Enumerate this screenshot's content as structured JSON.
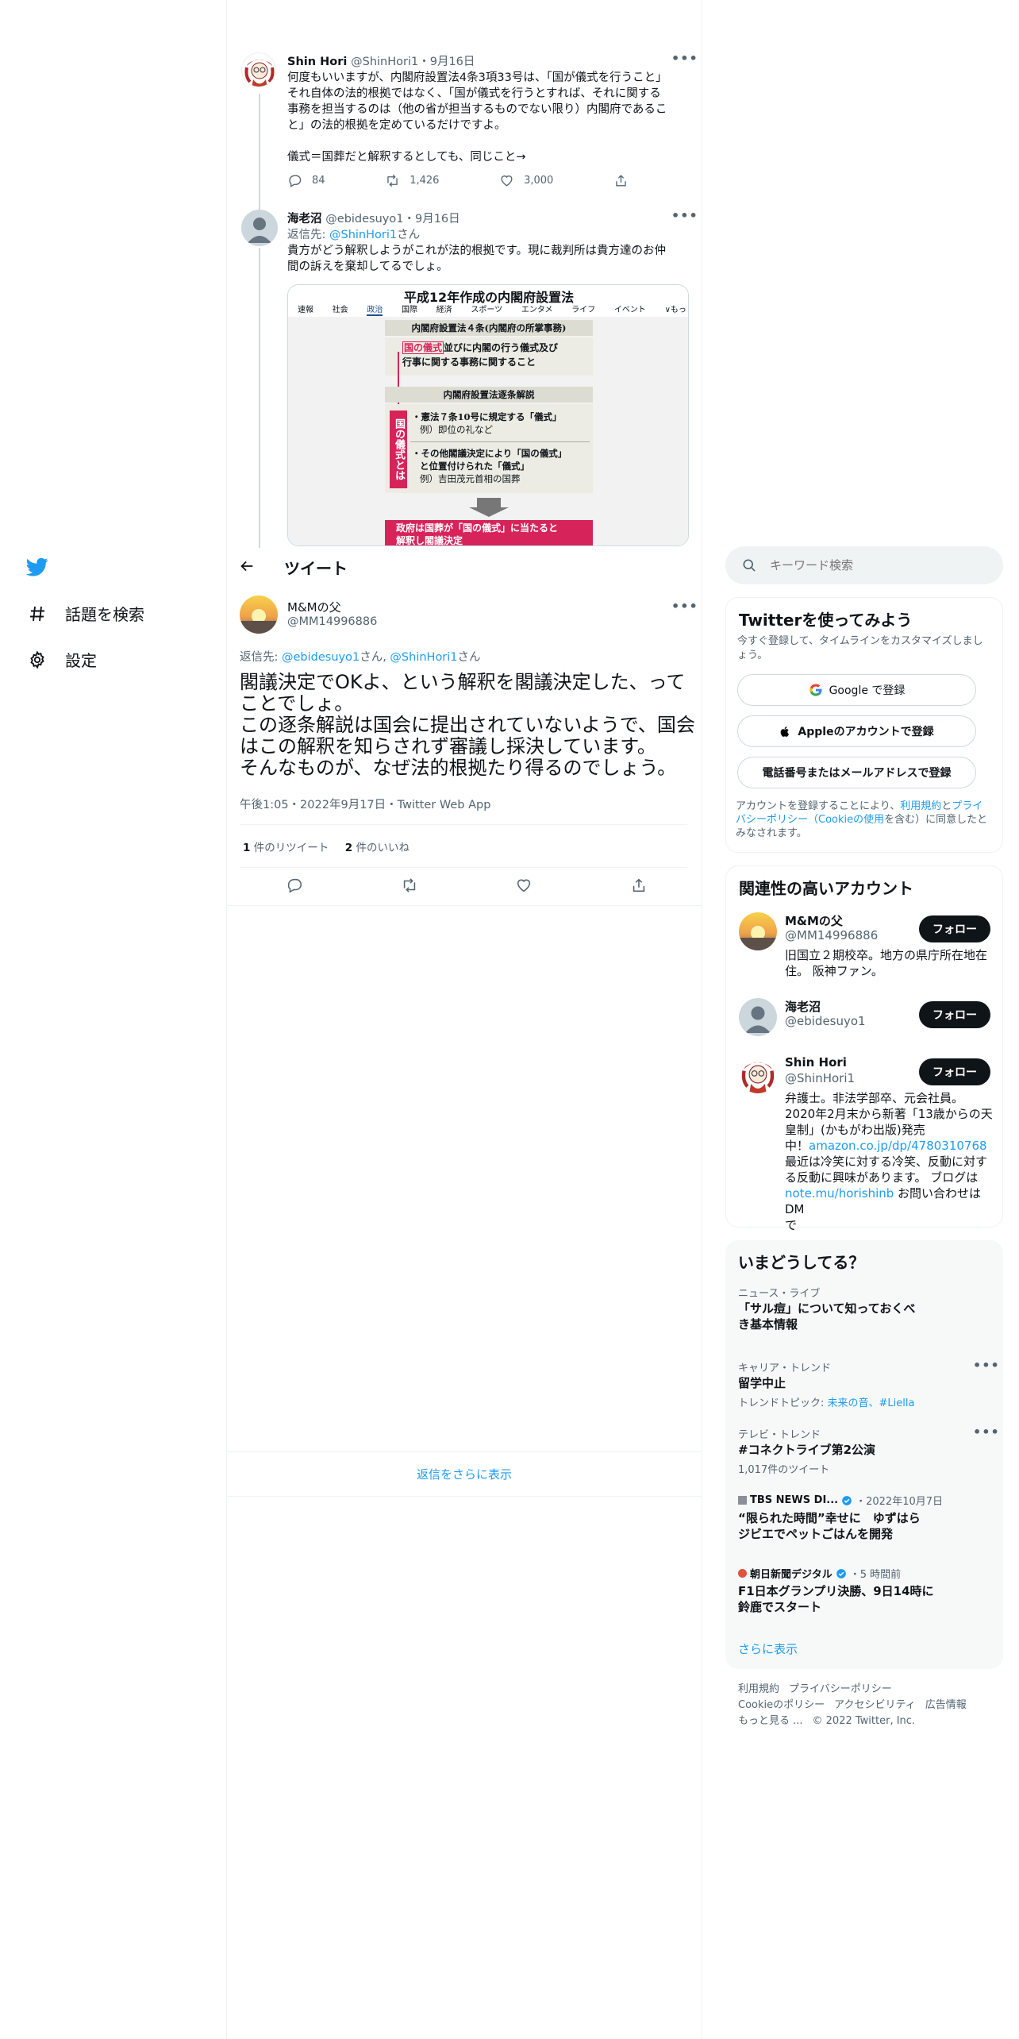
{
  "nav": {
    "explore_label": "話題を検索",
    "settings_label": "設定"
  },
  "header": {
    "title": "ツイート"
  },
  "thread": [
    {
      "name": "Shin Hori",
      "handle": "@ShinHori1",
      "date": "・9月16日",
      "text": "何度もいいますが、内閣府設置法4条3項33号は、「国が儀式を行うこと」\nそれ自体の法的根拠ではなく、「国が儀式を行うとすれば、それに関する\n事務を担当するのは（他の省が担当するものでない限り）内閣府であるこ\nと」の法的根拠を定めているだけですよ。\n\n儀式＝国葬だと解釈するとしても、同じこと→",
      "replies": "84",
      "retweets": "1,426",
      "likes": "3,000"
    },
    {
      "name": "海老沼",
      "handle": "@ebidesuyo1",
      "date": "・9月16日",
      "reply_prefix": "返信先: ",
      "reply_to": "@ShinHori1",
      "reply_suffix": "さん",
      "text": "貴方がどう解釈しようがこれが法的根拠です。現に裁判所は貴方達のお仲\n間の訴えを棄却してるでしょ。"
    }
  ],
  "embedded_image": {
    "title": "平成12年作成の内閣府設置法",
    "tabs": [
      "速報",
      "社会",
      "政治",
      "国際",
      "経済",
      "スポーツ",
      "エンタメ",
      "ライフ",
      "イベント",
      "∨もっ"
    ],
    "box1_head": "内閣府設置法４条(内閣府の所掌事務)",
    "box1_highlight": "国の儀式",
    "box1_text_a": "並びに内閣の行う儀式及び",
    "box1_text_b": "行事に関する事務に関すること",
    "box2_head": "内閣府設置法逐条解説",
    "side_label": "国の儀式とは",
    "item1_a": "・憲法７条10号に規定する「儀式」",
    "item1_b": "例）即位の礼など",
    "item2_a": "・その他閣議決定により「国の儀式」",
    "item2_b": "と位置付けられた「儀式」",
    "item2_c": "例）吉田茂元首相の国葬",
    "bottom_a": "政府は国葬が「国の儀式」に当たると",
    "bottom_b": "解釈し閣議決定"
  },
  "main_tweet": {
    "name": "M&Mの父",
    "handle": "@MM14996886",
    "reply_prefix": "返信先: ",
    "reply_to1": "@ebidesuyo1",
    "reply_mid": "さん, ",
    "reply_to2": "@ShinHori1",
    "reply_suffix": "さん",
    "text": "閣議決定でOKよ、という解釈を閣議決定した、って\nことでしょ。\nこの逐条解説は国会に提出されていないようで、国会\nはこの解釈を知らされず審議し採決しています。\nそんなものが、なぜ法的根拠たり得るのでしょう。",
    "meta": "午後1:05・2022年9月17日・Twitter Web App",
    "retweet_count": "1",
    "retweet_label": " 件のリツイート",
    "like_count": "2",
    "like_label": " 件のいいね"
  },
  "show_more_replies": "返信をさらに表示",
  "search": {
    "placeholder": "キーワード検索"
  },
  "signup": {
    "title": "Twitterを使ってみよう",
    "subtitle": "今すぐ登録して、タイムラインをカスタマイズしましょう。",
    "google": "Google で登録",
    "apple": "Appleのアカウントで登録",
    "phone": "電話番号またはメールアドレスで登録",
    "terms_a": "アカウントを登録することにより、",
    "terms_link1": "利用規約",
    "terms_b": "と",
    "terms_link2": "プライバシーポリシー",
    "terms_c": "（",
    "terms_link3": "Cookieの使用",
    "terms_d": "を含む）に同意したとみなされます。"
  },
  "relevant": {
    "title": "関連性の高いアカウント",
    "follow_label": "フォロー",
    "accounts": [
      {
        "name": "M&Mの父",
        "handle": "@MM14996886",
        "bio": "旧国立２期校卒。地方の県庁所在地在住。 阪神ファン。"
      },
      {
        "name": "海老沼",
        "handle": "@ebidesuyo1"
      },
      {
        "name": "Shin Hori",
        "handle": "@ShinHori1",
        "bio_a": "弁護士。非法学部卒、元会社員。\n2020年2月末から新著「13歳からの天\n皇制」(かもがわ出版)発売\n中！",
        "bio_link1": "amazon.co.jp/dp/4780310768",
        "bio_b": "\n最近は冷笑に対する冷笑、反動に対す\nる反動に興味があります。 ブログは\n",
        "bio_link2": "note.mu/horishinb",
        "bio_c": " お問い合わせはDM\nで"
      }
    ]
  },
  "trends": {
    "title": "いまどうしてる？",
    "items": [
      {
        "meta": "ニュース・ライブ",
        "title": "「サル痘」について知っておくべ\nき基本情報"
      },
      {
        "meta": "キャリア・トレンド",
        "title": "留学中止",
        "sub_prefix": "トレンドトピック: ",
        "sub_link": "未来の音、#Liella"
      },
      {
        "meta": "テレビ・トレンド",
        "title": "#コネクトライブ第2公演",
        "sub": "1,017件のツイート"
      },
      {
        "source": "TBS NEWS DI...",
        "date": "・2022年10月7日",
        "title": "“限られた時間”幸せに　ゆずはら\nジビエでペットごはんを開発"
      },
      {
        "source": "朝日新聞デジタル",
        "date": "・5 時間前",
        "title": "F1日本グランプリ決勝、9日14時に\n鈴鹿でスタート"
      }
    ],
    "more": "さらに表示"
  },
  "footer": {
    "links": [
      "利用規約",
      "プライバシーポリシー",
      "Cookieのポリシー",
      "アクセシビリティ",
      "広告情報",
      "もっと見る ..."
    ],
    "copyright": "© 2022 Twitter, Inc."
  },
  "colors": {
    "accent": "#1d9bf0",
    "text": "#0f1419",
    "muted": "#536471",
    "border": "#eff3f4",
    "panel": "#f7f9f9",
    "highlight_red": "#d6245a"
  }
}
